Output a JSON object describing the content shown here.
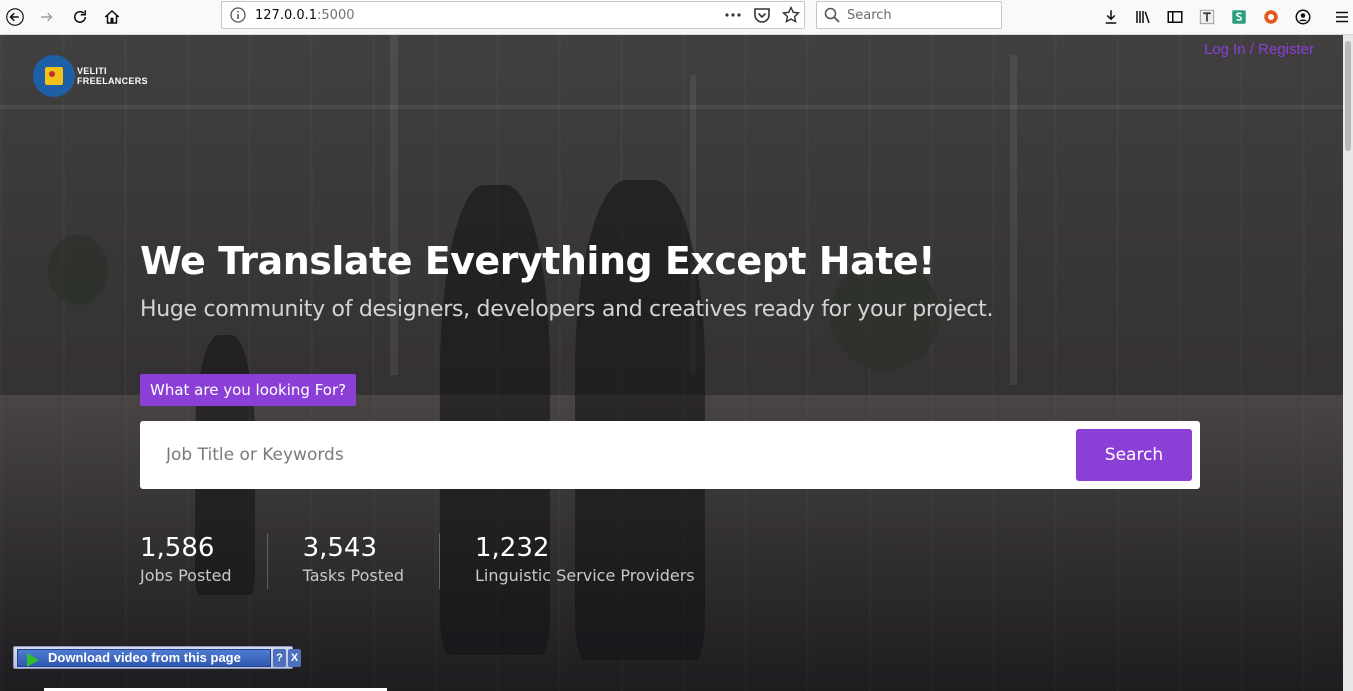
{
  "browser": {
    "url_host": "127.0.0.1",
    "url_port": ":5000",
    "search_placeholder": "Search"
  },
  "site": {
    "logo_line1": "VELITI",
    "logo_line2": "FREELANCERS",
    "auth_link": "Log In / Register"
  },
  "hero": {
    "title": "We Translate Everything Except Hate!",
    "subtitle": "Huge community of designers, developers and creatives ready for your project.",
    "tag": "What are you looking For?",
    "search_placeholder": "Job Title or Keywords",
    "search_button": "Search"
  },
  "stats": [
    {
      "value": "1,586",
      "label": "Jobs Posted"
    },
    {
      "value": "3,543",
      "label": "Tasks Posted"
    },
    {
      "value": "1,232",
      "label": "Linguistic Service Providers"
    }
  ],
  "download_bar": {
    "label": "Download video from this page",
    "help": "?",
    "close": "X"
  },
  "colors": {
    "accent": "#8b3fd6",
    "overlay": "#1e1c20"
  }
}
